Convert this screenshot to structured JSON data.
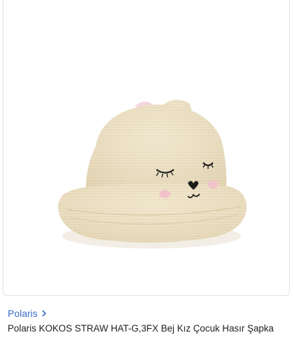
{
  "product": {
    "image_alt": "straw-hat-image",
    "brand": "Polaris",
    "title": "Polaris KOKOS STRAW HAT-G,3FX Bej Kız Çocuk Hasır Şapka"
  },
  "icons": {
    "brand_chevron": "chevron-right-icon"
  },
  "colors": {
    "brand_link": "#3b6cc7",
    "title_text": "#1f1f1f",
    "card_border": "#e2e2e2",
    "hat_straw": "#efe2c4"
  }
}
